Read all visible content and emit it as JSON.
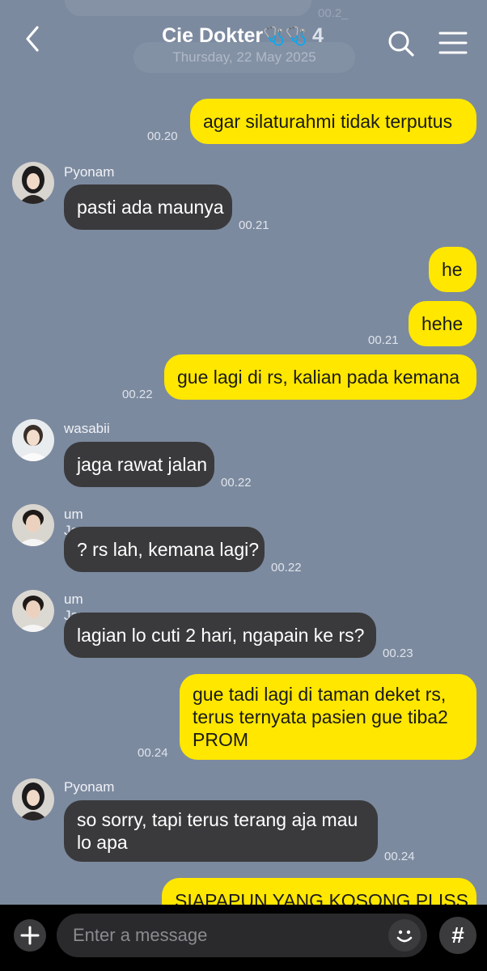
{
  "header": {
    "faded_prev_time": "00.2_",
    "date_divider": "Thursday, 22 May 2025",
    "title": "Cie Dokter",
    "title_emoji": "🩺🩺",
    "member_count": "4"
  },
  "messages": [
    {
      "dir": "out",
      "text": "agar silaturahmi tidak terputus",
      "time": "00.20"
    },
    {
      "dir": "in",
      "sender": "Pyonam",
      "text": "pasti ada maunya",
      "time": "00.21"
    },
    {
      "dir": "out",
      "text": "he",
      "time": ""
    },
    {
      "dir": "out",
      "text": "hehe",
      "time": "00.21"
    },
    {
      "dir": "out",
      "text": "gue lagi di rs, kalian pada kemana",
      "time": "00.22"
    },
    {
      "dir": "in",
      "sender": "wasabii",
      "text": "jaga rawat jalan",
      "time": "00.22"
    },
    {
      "dir": "in",
      "sender": "um Jay",
      "text": "? rs lah, kemana lagi?",
      "time": "00.22"
    },
    {
      "dir": "in",
      "sender": "um Jay",
      "text": "lagian lo cuti 2 hari, ngapain ke rs?",
      "time": "00.23"
    },
    {
      "dir": "out",
      "text": "gue tadi lagi di taman deket rs, terus ternyata pasien gue tiba2 PROM",
      "time": "00.24"
    },
    {
      "dir": "in",
      "sender": "Pyonam",
      "text": "so sorry, tapi terus terang aja mau lo apa",
      "time": "00.24"
    },
    {
      "dir": "out",
      "text": "SIAPAPUN YANG KOSONG PLISS",
      "time": ""
    }
  ],
  "input": {
    "placeholder": "Enter a message",
    "hash_label": "#"
  },
  "colors": {
    "background": "#7c8a9f",
    "outgoing_bubble": "#ffe700",
    "incoming_bubble": "#3a3a3c",
    "input_bar": "#000000"
  }
}
